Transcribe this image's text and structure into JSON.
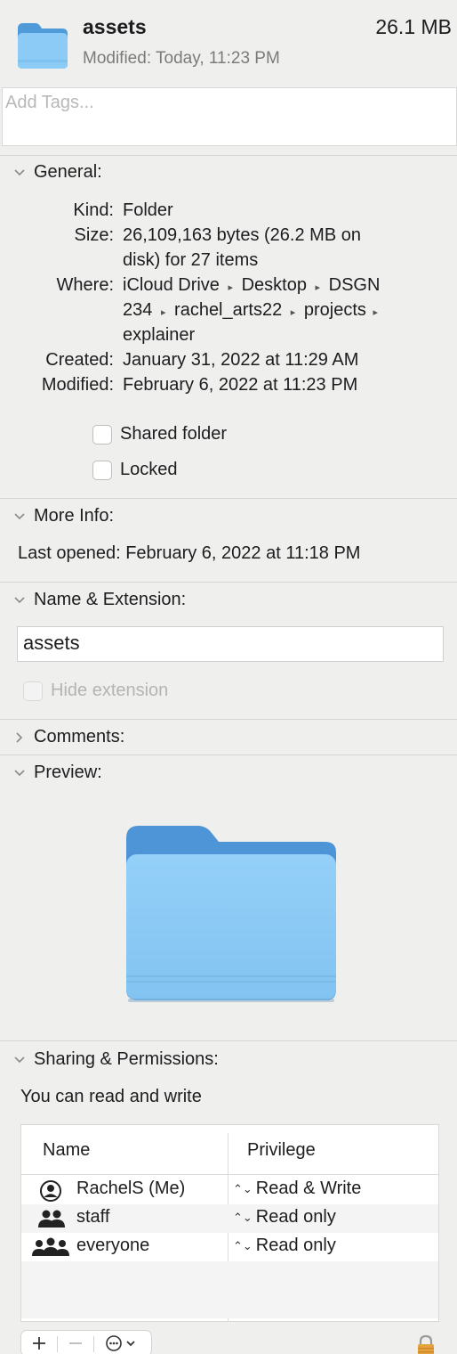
{
  "header": {
    "name": "assets",
    "size": "26.1 MB",
    "modified": "Modified: Today, 11:23 PM"
  },
  "tags": {
    "placeholder": "Add Tags..."
  },
  "general": {
    "title": "General:",
    "kind_label": "Kind:",
    "kind_value": "Folder",
    "size_label": "Size:",
    "size_value_1": "26,109,163 bytes (26.2 MB on",
    "size_value_2": "disk) for 27 items",
    "where_label": "Where:",
    "where_1_a": "iCloud Drive",
    "where_1_b": "Desktop",
    "where_1_c": "DSGN",
    "where_2_a": "234",
    "where_2_b": "rachel_arts22",
    "where_2_c": "projects",
    "where_3": "explainer",
    "created_label": "Created:",
    "created_value": "January 31, 2022 at 11:29 AM",
    "modified_label": "Modified:",
    "modified_value": "February 6, 2022 at 11:23 PM",
    "shared_folder": "Shared folder",
    "locked": "Locked"
  },
  "more_info": {
    "title": "More Info:",
    "last_opened": "Last opened: February 6, 2022 at 11:18 PM"
  },
  "name_ext": {
    "title": "Name & Extension:",
    "value": "assets",
    "hide_extension": "Hide extension"
  },
  "comments": {
    "title": "Comments:"
  },
  "preview": {
    "title": "Preview:"
  },
  "sharing": {
    "title": "Sharing & Permissions:",
    "status": "You can read and write",
    "col_name": "Name",
    "col_privilege": "Privilege",
    "rows": [
      {
        "name": "RachelS (Me)",
        "privilege": "Read & Write",
        "icon": "user-icon"
      },
      {
        "name": "staff",
        "privilege": "Read only",
        "icon": "group-icon"
      },
      {
        "name": "everyone",
        "privilege": "Read only",
        "icon": "everyone-icon"
      }
    ]
  },
  "colors": {
    "folder_blue": "#8ccbf5",
    "folder_tab": "#4f9ad9"
  }
}
